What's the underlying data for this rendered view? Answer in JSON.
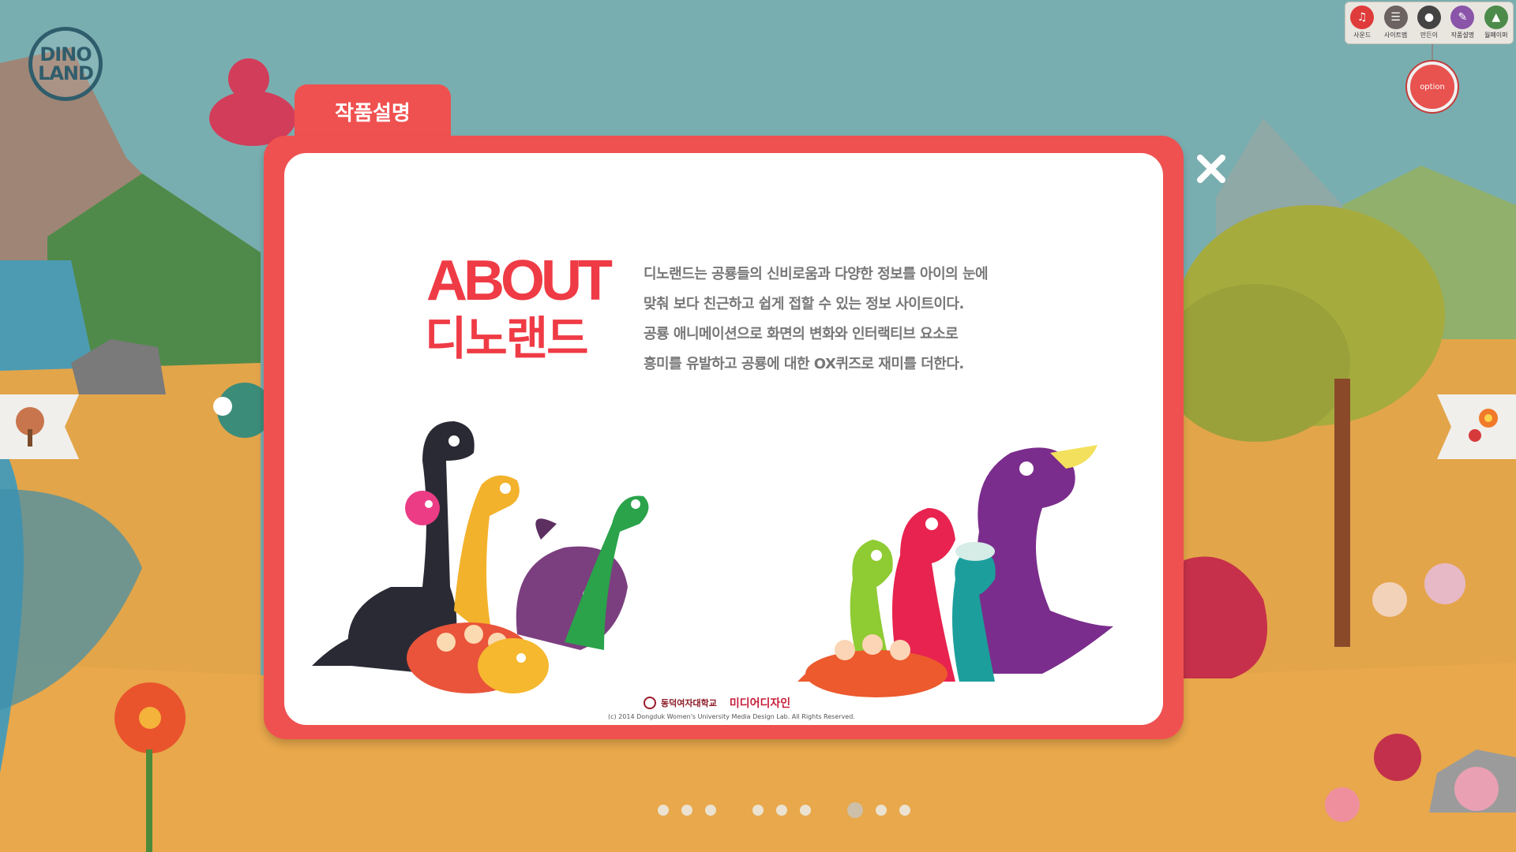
{
  "logo": {
    "line1": "DINO",
    "line2": "LAND"
  },
  "toolbar": {
    "items": [
      {
        "label": "사운드",
        "icon": "speaker-icon",
        "color": "#e03b3b"
      },
      {
        "label": "사이트맵",
        "icon": "sitemap-icon",
        "color": "#6c6262"
      },
      {
        "label": "만든이",
        "icon": "person-icon",
        "color": "#444444"
      },
      {
        "label": "작품설명",
        "icon": "description-icon",
        "color": "#8a55a8"
      },
      {
        "label": "월페이퍼",
        "icon": "wallpaper-icon",
        "color": "#4d8b4a"
      }
    ]
  },
  "option": {
    "label": "option"
  },
  "modal": {
    "tab_label": "작품설명",
    "about_title": "ABOUT",
    "about_subtitle": "디노랜드",
    "description": [
      "디노랜드는 공룡들의 신비로움과 다양한 정보를 아이의 눈에",
      "맞춰 보다 친근하고 쉽게 접할 수 있는 정보 사이트이다.",
      "공룡 애니메이션으로 화면의 변화와 인터랙티브 요소로",
      "흥미를 유발하고 공룡에 대한 OX퀴즈로 재미를 더한다."
    ],
    "footer": {
      "university": "동덕여자대학교",
      "department": "미디어디자인",
      "copyright": "(c) 2014 Dongduk Women's University Media Design Lab. All Rights Reserved."
    }
  },
  "pagination": {
    "groups": 3,
    "dots_per_group": 3,
    "active_index": 6
  },
  "colors": {
    "accent": "#ef5150",
    "title": "#ef3b45",
    "text": "#777777",
    "sky": "#79aeb0",
    "ground": "#e3a54a"
  }
}
